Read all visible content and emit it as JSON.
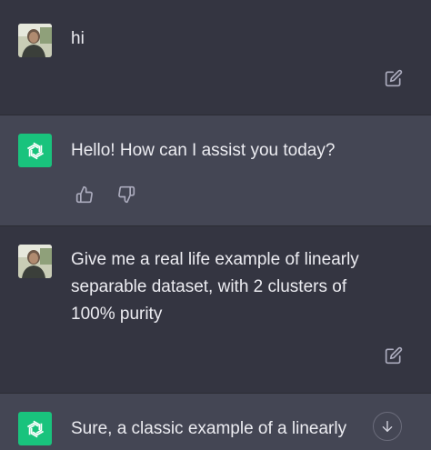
{
  "conversation": {
    "messages": [
      {
        "role": "user",
        "text": "hi",
        "avatar_icon": "user-photo-avatar",
        "action_icon": "edit-icon"
      },
      {
        "role": "assistant",
        "text": "Hello! How can I assist you today?",
        "avatar_icon": "openai-logo-icon",
        "action_icons": [
          "thumbs-up-icon",
          "thumbs-down-icon"
        ]
      },
      {
        "role": "user",
        "text": "Give me a real life example of linearly\nseparable dataset, with 2 clusters of\n100% purity",
        "avatar_icon": "user-photo-avatar",
        "action_icon": "edit-icon"
      },
      {
        "role": "assistant",
        "text": "Sure, a classic example of a linearly",
        "avatar_icon": "openai-logo-icon"
      }
    ],
    "scroll_button_icon": "arrow-down-icon"
  },
  "colors": {
    "background_user": "#343541",
    "background_assistant": "#444654",
    "assistant_avatar": "#19c37d",
    "text": "#ececf1",
    "icon": "#acacbe"
  }
}
